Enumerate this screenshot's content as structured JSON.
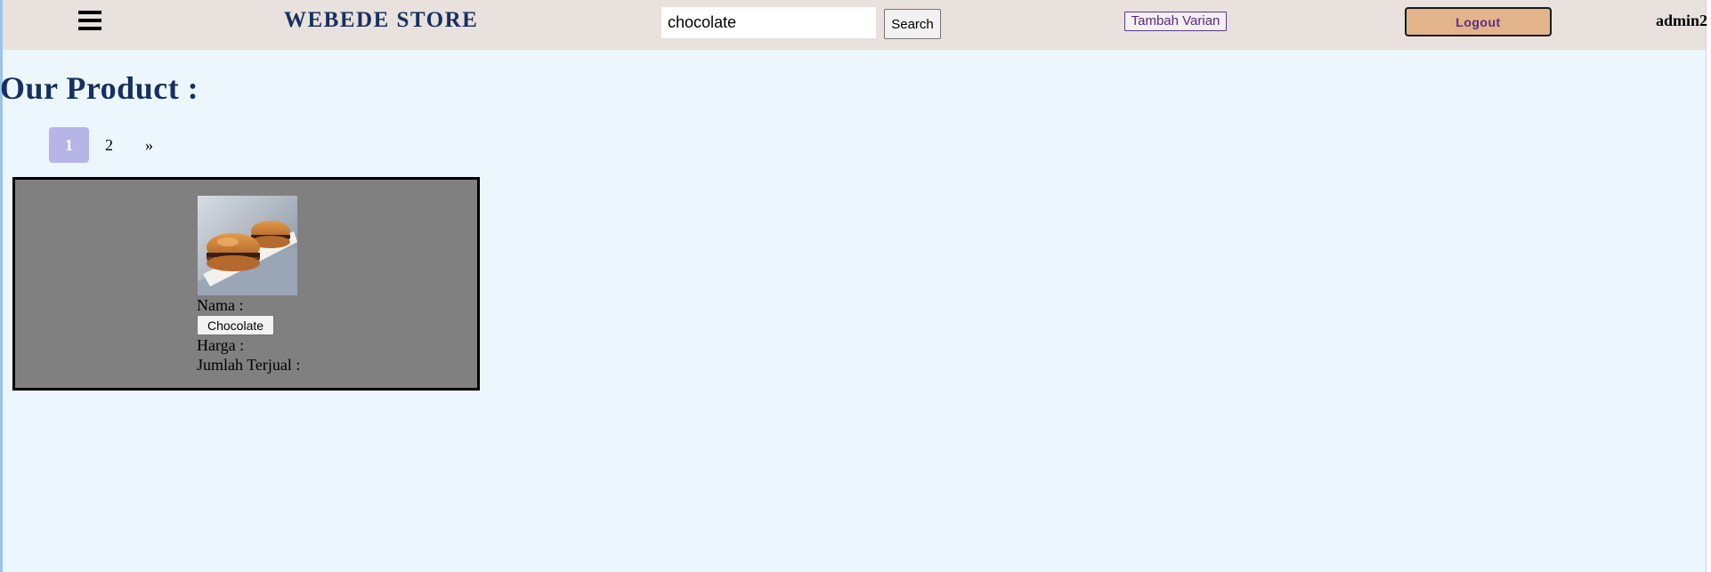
{
  "header": {
    "menu_icon": "hamburger-menu-icon",
    "brand": "WEBEDE STORE",
    "search": {
      "value": "chocolate",
      "placeholder": ""
    },
    "search_label": "Search",
    "tambah_label": "Tambah Varian",
    "logout_label": "Logout",
    "username": "admin2"
  },
  "main": {
    "title": "Our Product :",
    "pagination": {
      "pages": [
        "1",
        "2"
      ],
      "next": "»",
      "current": "1"
    },
    "products": [
      {
        "image_icon": "dorayaki-product-image",
        "nama_label": "Nama :",
        "name": "Chocolate",
        "harga_label": "Harga :",
        "terjual_label": "Jumlah Terjual :"
      }
    ]
  },
  "colors": {
    "page_bg": "#ecf7fd",
    "navbar_bg": "#e8e1dd",
    "brand": "#16305f",
    "logout_bg": "#e3b48a",
    "accent_purple": "#5b2a86",
    "pagination_active": "#b7b4e7",
    "card_bg": "#808080"
  }
}
